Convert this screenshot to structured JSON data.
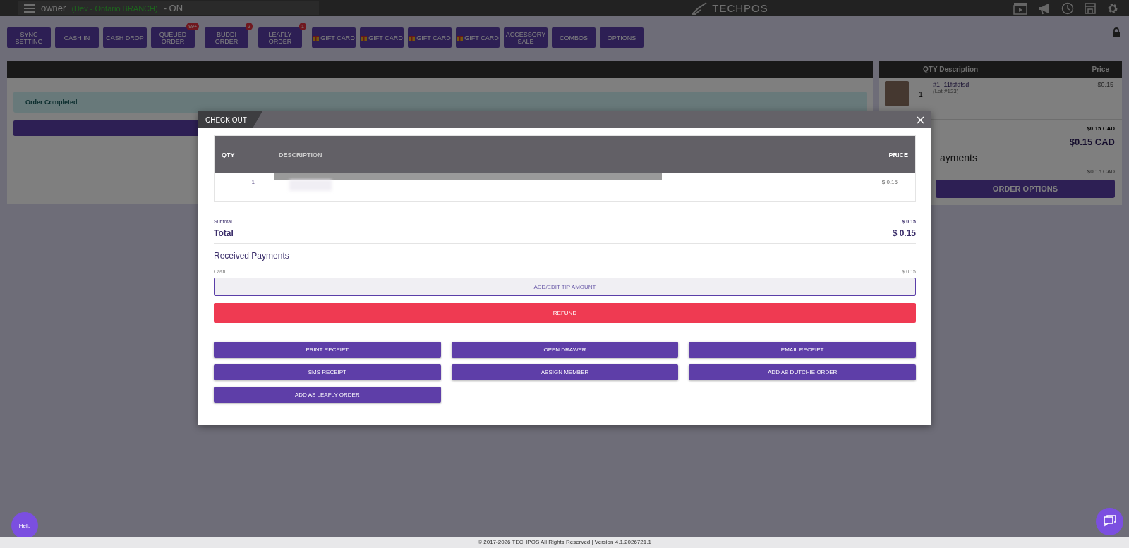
{
  "top_bar": {
    "user": "owner",
    "branch": "(Dev - Ontario BRANCH)",
    "status": "- ON",
    "logo": "TECHPOS"
  },
  "toolbar": [
    {
      "kind": "plain",
      "lines": [
        "SYNC",
        "SETTING"
      ]
    },
    {
      "kind": "plain",
      "lines": [
        "CASH IN"
      ]
    },
    {
      "kind": "plain",
      "lines": [
        "CASH DROP"
      ]
    },
    {
      "kind": "plain",
      "lines": [
        "QUEUED",
        "ORDER"
      ],
      "badge": "99+"
    },
    {
      "kind": "plain",
      "lines": [
        "BUDDI",
        "ORDER"
      ],
      "badge": "2"
    },
    {
      "kind": "plain",
      "lines": [
        "LEAFLY",
        "ORDER"
      ],
      "badge": "1"
    },
    {
      "kind": "gift",
      "lines": [
        "GIFT CARD"
      ]
    },
    {
      "kind": "gift",
      "lines": [
        "GIFT CARD"
      ]
    },
    {
      "kind": "gift",
      "lines": [
        "GIFT CARD"
      ]
    },
    {
      "kind": "gift",
      "lines": [
        "GIFT CARD"
      ]
    },
    {
      "kind": "plain",
      "lines": [
        "ACCESSORY",
        "SALE"
      ]
    },
    {
      "kind": "plain",
      "lines": [
        "COMBOS"
      ]
    },
    {
      "kind": "plain",
      "lines": [
        "OPTIONS"
      ]
    }
  ],
  "order_panel": {
    "alert": "Order Completed"
  },
  "cart": {
    "columns": [
      "QTY Description",
      "Price"
    ],
    "items": [
      {
        "name": "#1- 11fsfdfsd",
        "lot": "(Lot #123)",
        "qty": "1",
        "price": "$0.15"
      }
    ],
    "subtotal": "$0.15 CAD",
    "total": "$0.15 CAD",
    "payments_heading": "ayments",
    "payment_amount": "$0.15 CAD",
    "button": "ORDER OPTIONS"
  },
  "modal": {
    "title": "CHECK OUT",
    "columns": [
      "QTY",
      "DESCRIPTION",
      "PRICE"
    ],
    "rows": [
      {
        "qty": "1",
        "price": "$ 0.15"
      }
    ],
    "subtotal_label": "Subtotal",
    "subtotal": "$ 0.15",
    "total_label": "Total",
    "total": "$ 0.15",
    "payments_heading": "Received Payments",
    "payments": [
      {
        "method": "Cash",
        "amount": "$ 0.15"
      }
    ],
    "tip_button": "ADD/EDIT TIP AMOUNT",
    "refund_button": "REFUND",
    "actions": [
      "PRINT RECEIPT",
      "OPEN DRAWER",
      "EMAIL RECEIPT",
      "SMS RECEIPT",
      "ASSIGN MEMBER",
      "ADD AS DUTCHIE ORDER",
      "ADD AS LEAFLY ORDER"
    ]
  },
  "footer": "© 2017-2026 TECHPOS All Rights Reserved | Version 4.1.2026721.1",
  "help": "Help"
}
